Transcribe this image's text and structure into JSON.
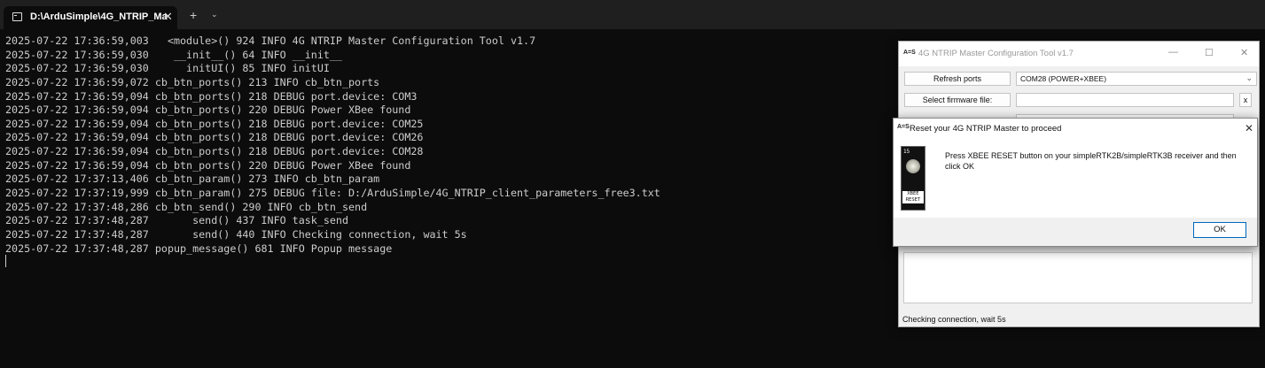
{
  "terminal": {
    "tab_title": "D:\\ArduSimple\\4G_NTRIP_Ma",
    "tab_close_glyph": "✕",
    "newtab_glyph": "+",
    "menu_glyph": "⌄",
    "lines": [
      "2025-07-22 17:36:59,003   <module>() 924 INFO 4G NTRIP Master Configuration Tool v1.7",
      "2025-07-22 17:36:59,030    __init__() 64 INFO __init__",
      "2025-07-22 17:36:59,030      initUI() 85 INFO initUI",
      "2025-07-22 17:36:59,072 cb_btn_ports() 213 INFO cb_btn_ports",
      "2025-07-22 17:36:59,094 cb_btn_ports() 218 DEBUG port.device: COM3",
      "2025-07-22 17:36:59,094 cb_btn_ports() 220 DEBUG Power XBee found",
      "2025-07-22 17:36:59,094 cb_btn_ports() 218 DEBUG port.device: COM25",
      "2025-07-22 17:36:59,094 cb_btn_ports() 218 DEBUG port.device: COM26",
      "2025-07-22 17:36:59,094 cb_btn_ports() 218 DEBUG port.device: COM28",
      "2025-07-22 17:36:59,094 cb_btn_ports() 220 DEBUG Power XBee found",
      "2025-07-22 17:37:13,406 cb_btn_param() 273 INFO cb_btn_param",
      "2025-07-22 17:37:19,999 cb_btn_param() 275 DEBUG file: D:/ArduSimple/4G_NTRIP_client_parameters_free3.txt",
      "2025-07-22 17:37:48,286 cb_btn_send() 290 INFO cb_btn_send",
      "2025-07-22 17:37:48,287       send() 437 INFO task_send",
      "2025-07-22 17:37:48,287       send() 440 INFO Checking connection, wait 5s",
      "2025-07-22 17:37:48,287 popup_message() 681 INFO Popup message"
    ]
  },
  "main_window": {
    "icon_text": "A=S",
    "title": "4G NTRIP Master Configuration Tool v1.7",
    "minimize_glyph": "—",
    "maximize_glyph": "☐",
    "close_glyph": "✕",
    "refresh_ports_label": "Refresh ports",
    "port_value": "COM28 (POWER+XBEE)",
    "dropdown_glyph": "⌄",
    "select_firmware_label": "Select firmware file:",
    "firmware_clear_label": "x",
    "status_text": "Checking connection, wait 5s"
  },
  "popup": {
    "icon_text": "A=S",
    "title": "Reset your 4G NTRIP Master to proceed",
    "close_glyph": "✕",
    "image_number": "15",
    "image_label": "XBEE RESET",
    "message": "Press XBEE RESET button on your simpleRTK2B/simpleRTK3B receiver and then click OK",
    "ok_label": "OK"
  },
  "colors": {
    "terminal_bg": "#0c0c0c",
    "terminal_text": "#cccccc",
    "dialog_bg": "#f0f0f0",
    "accent_blue": "#0067c0"
  }
}
